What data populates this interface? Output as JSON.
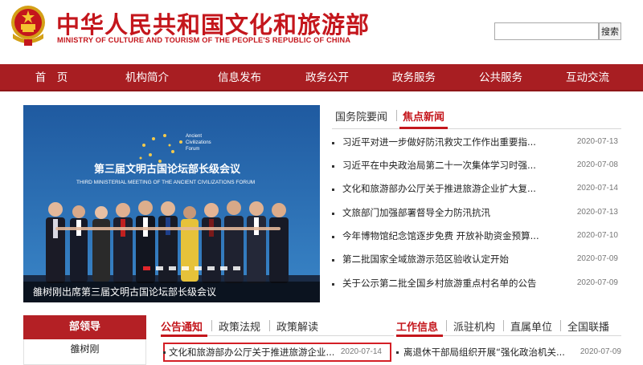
{
  "header": {
    "title_cn": "中华人民共和国文化和旅游部",
    "title_en": "MINISTRY OF CULTURE AND TOURISM OF THE PEOPLE'S REPUBLIC OF CHINA",
    "search_value": "",
    "search_button": "搜索"
  },
  "nav": {
    "items": [
      "首　页",
      "机构简介",
      "信息发布",
      "政务公开",
      "政务服务",
      "公共服务",
      "互动交流"
    ]
  },
  "slider": {
    "banner_title_cn": "第三届文明古国论坛部长级会议",
    "banner_title_en": "THIRD MINISTERIAL MEETING OF THE ANCIENT CIVILIZATIONS FORUM",
    "logo_text_1": "Ancient",
    "logo_text_2": "Civilizations",
    "logo_text_3": "Forum",
    "caption": "雒树刚出席第三届文明古国论坛部长级会议",
    "active_dot": 0,
    "dot_count": 8
  },
  "news_tabs": {
    "tab1": "国务院要闻",
    "tab2": "焦点新闻",
    "active": "焦点新闻"
  },
  "news": [
    {
      "title": "习近平对进一步做好防汛救灾工作作出重要指...",
      "date": "2020-07-13"
    },
    {
      "title": "习近平在中央政治局第二十一次集体学习时强...",
      "date": "2020-07-08"
    },
    {
      "title": "文化和旅游部办公厅关于推进旅游企业扩大复...",
      "date": "2020-07-14"
    },
    {
      "title": "文旅部门加强部署督导全力防汛抗汛",
      "date": "2020-07-13"
    },
    {
      "title": "今年博物馆纪念馆逐步免费 开放补助资金预算...",
      "date": "2020-07-10"
    },
    {
      "title": "第二批国家全域旅游示范区验收认定开始",
      "date": "2020-07-09"
    },
    {
      "title": "关于公示第二批全国乡村旅游重点村名单的公告",
      "date": "2020-07-09"
    }
  ],
  "leaders": {
    "heading": "部领导",
    "name": "雒树刚"
  },
  "mid_tabs": {
    "tab1": "公告通知",
    "tab2": "政策法规",
    "tab3": "政策解读",
    "active": "公告通知"
  },
  "mid_item": {
    "title": "文化和旅游部办公厅关于推进旅游企业...",
    "date": "2020-07-14"
  },
  "right_tabs": {
    "tab1": "工作信息",
    "tab2": "派驻机构",
    "tab3": "直属单位",
    "tab4": "全国联播",
    "active": "工作信息"
  },
  "right_item": {
    "title": "离退休干部局组织开展“强化政治机关...",
    "date": "2020-07-09"
  },
  "colors": {
    "brand_red": "#c4161c",
    "nav_red": "#a81e22"
  }
}
